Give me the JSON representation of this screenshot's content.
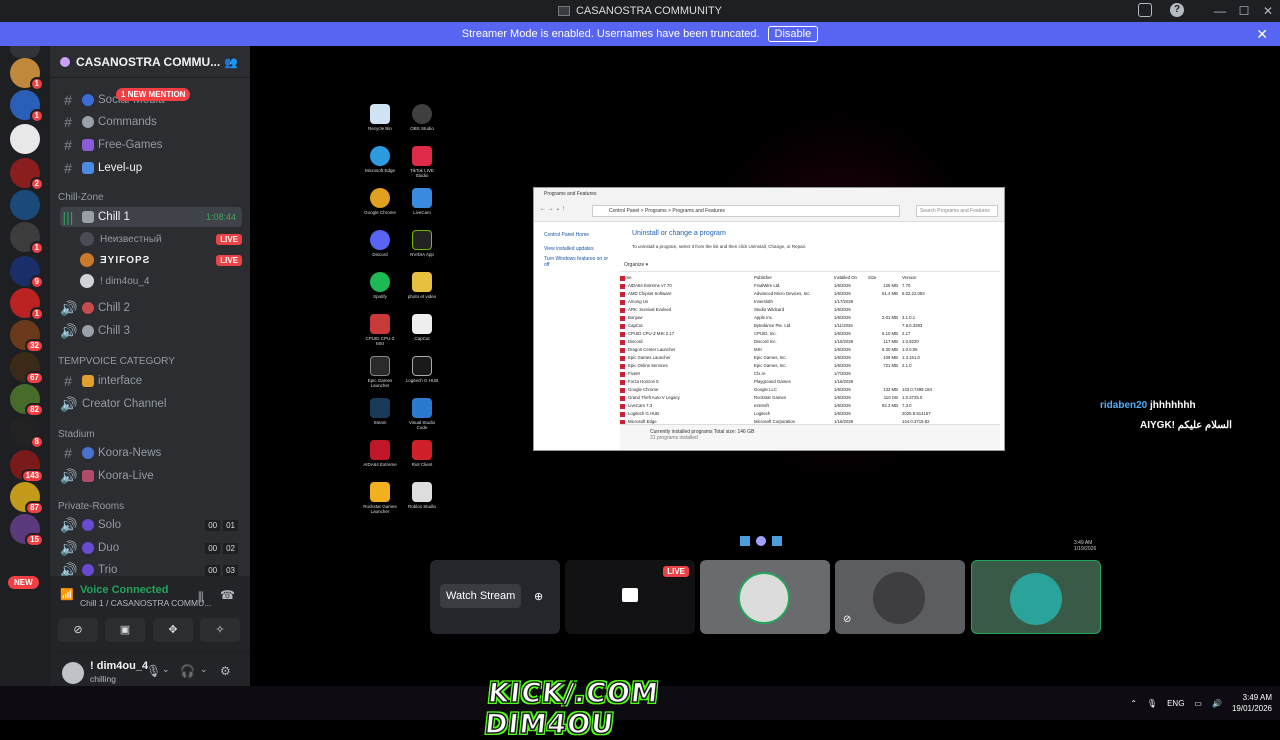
{
  "window": {
    "title": "CASANOSTRA COMMUNITY"
  },
  "banner": {
    "text": "Streamer Mode is enabled. Usernames have been truncated.",
    "disable_label": "Disable"
  },
  "guild_badges": [
    "1",
    "1",
    "1",
    "2",
    "1",
    "9",
    "1",
    "32",
    "67",
    "82",
    "8",
    "143",
    "87",
    "15"
  ],
  "new_label": "NEW",
  "server": {
    "name": "CASANOSTRA COMMU...",
    "mention_label": "1 NEW MENTION"
  },
  "channels_top": [
    {
      "label": "Social-Media"
    },
    {
      "label": "Commands"
    },
    {
      "label": "Free-Games"
    },
    {
      "label": "Level-up"
    }
  ],
  "categories": {
    "chill": "Chill-Zone",
    "tempvoice": "TEMPVOICE CATEGORY",
    "stadium": "Stadium",
    "private": "Private-Rooms"
  },
  "chill_channel": {
    "label": "Chill 1",
    "timer": "1:08:44"
  },
  "voice_users": [
    {
      "name": "Неизвестный",
      "live": "LIVE"
    },
    {
      "name": "ƎYIFOPƧ",
      "live": "LIVE"
    },
    {
      "name": "! dim4ou_4"
    }
  ],
  "chill_others": [
    "Chill 2",
    "Chill 3"
  ],
  "tempvoice": {
    "interface": "interface",
    "creator": "Creator Channel"
  },
  "stadium": [
    "Koora-News",
    "Koora-Live"
  ],
  "private": [
    {
      "label": "Solo",
      "c1": "00",
      "c2": "01"
    },
    {
      "label": "Duo",
      "c1": "00",
      "c2": "02"
    },
    {
      "label": "Trio",
      "c1": "00",
      "c2": "03"
    }
  ],
  "voice_panel": {
    "title": "Voice Connected",
    "subtitle": "Chill 1 / CASANOSTRA COMMU..."
  },
  "user": {
    "name": "! dim4ou_4",
    "status": "chilling"
  },
  "desktop_icons": [
    "Recycle Bin",
    "OBS Studio",
    "Microsoft Edge",
    "TikTok LIVE Studio",
    "Google Chrome",
    "LiveCam",
    "Discord",
    "NVIDIA App",
    "Spotify",
    "photo et video",
    "CPUID CPU-Z MSI",
    "CapCut",
    "Epic Games Launcher",
    "Logitech G HUB",
    "Steam",
    "Visual Studio Code",
    "AIDA64 Extreme",
    "Riot Client",
    "Rockstar Games Launcher",
    "Roblox Studio"
  ],
  "cp": {
    "title": "Programs and Features",
    "path": "Control Panel  >  Programs  >  Programs and Features",
    "search": "Search Programs and Features",
    "left_links": [
      "Control Panel Home",
      "View installed updates",
      "Turn Windows features on or off"
    ],
    "heading": "Uninstall or change a program",
    "desc": "To uninstall a program, select it from the list and then click Uninstall, Change, or Repair.",
    "organize": "Organize ▾",
    "cols": [
      "Name",
      "Publisher",
      "Installed On",
      "Size",
      "Version"
    ],
    "rows": [
      [
        "AIDA64 Extreme v7.70",
        "FinalWire Ltd.",
        "1/6/2026",
        "125 MB",
        "7.70"
      ],
      [
        "AMD Chipset Software",
        "Advanced Micro Devices, Inc.",
        "1/6/2026",
        "61.4 MB",
        "6.02.22.053"
      ],
      [
        "Among Us",
        "Innersloth",
        "1/17/2026",
        "",
        ""
      ],
      [
        "ARK: Survival Evolved",
        "Studio Wildcard",
        "1/6/2026",
        "",
        ""
      ],
      [
        "Bonjour",
        "Apple Inc.",
        "1/6/2026",
        "2.01 MB",
        "3.1.0.1"
      ],
      [
        "CapCut",
        "Bytedance Pte. Ltd",
        "1/11/2026",
        "",
        "7.8.0.3283"
      ],
      [
        "CPUID CPU-Z MSI 2.17",
        "CPUID, Inc.",
        "1/6/2026",
        "6.10 MB",
        "2.17"
      ],
      [
        "Discord",
        "Discord Inc.",
        "1/15/2026",
        "117 MB",
        "1.0.9220"
      ],
      [
        "Dragon Center Launcher",
        "MSI",
        "1/6/2026",
        "5.30 MB",
        "1.0.0.05"
      ],
      [
        "Epic Games Launcher",
        "Epic Games, Inc.",
        "1/6/2026",
        "109 MB",
        "1.3.161.0"
      ],
      [
        "Epic Online Services",
        "Epic Games, Inc.",
        "1/6/2026",
        "721 MB",
        "2.1.0"
      ],
      [
        "FiveM",
        "Cfx.re",
        "1/7/2026",
        "",
        ""
      ],
      [
        "Forza Horizon 5",
        "Playground Games",
        "1/16/2026",
        "",
        ""
      ],
      [
        "Google Chrome",
        "Google LLC",
        "1/6/2026",
        "132 MB",
        "143.0.7499.194"
      ],
      [
        "Grand Theft Auto V Legacy",
        "Rockstar Games",
        "1/6/2026",
        "110 GB",
        "1.0.3725.0"
      ],
      [
        "LiveCam 7.3",
        "e2eSoft",
        "1/6/2026",
        "82.3 MB",
        "7.3.0"
      ],
      [
        "Logitech G HUB",
        "Logitech",
        "1/6/2026",
        "",
        "2025.9.814157"
      ],
      [
        "Microsoft Edge",
        "Microsoft Corporation",
        "1/16/2026",
        "",
        "144.0.3719.82"
      ]
    ],
    "footer_main": "Currently installed programs  Total size:   146 GB",
    "footer_sub": "31 programs installed"
  },
  "chat": [
    {
      "user": "ridaben20",
      "msg": "jhhhhhhh"
    },
    {
      "user": "AIYGK!",
      "msg": "السلام عليكم"
    }
  ],
  "tiles": {
    "watch_label": "Watch Stream",
    "live_label": "LIVE"
  },
  "overlay": {
    "kick_text": "KICK/.COM DIM4OU"
  },
  "taskbar": {
    "lang": "ENG",
    "time": "3:49 AM",
    "date": "19/01/2026"
  },
  "mini_clock": {
    "time": "3:49 AM",
    "date": "1/19/2026"
  },
  "colors": {
    "blurple": "#5865f2",
    "green": "#23a55a",
    "red": "#ed4245",
    "sidebar": "#2b2d31"
  }
}
